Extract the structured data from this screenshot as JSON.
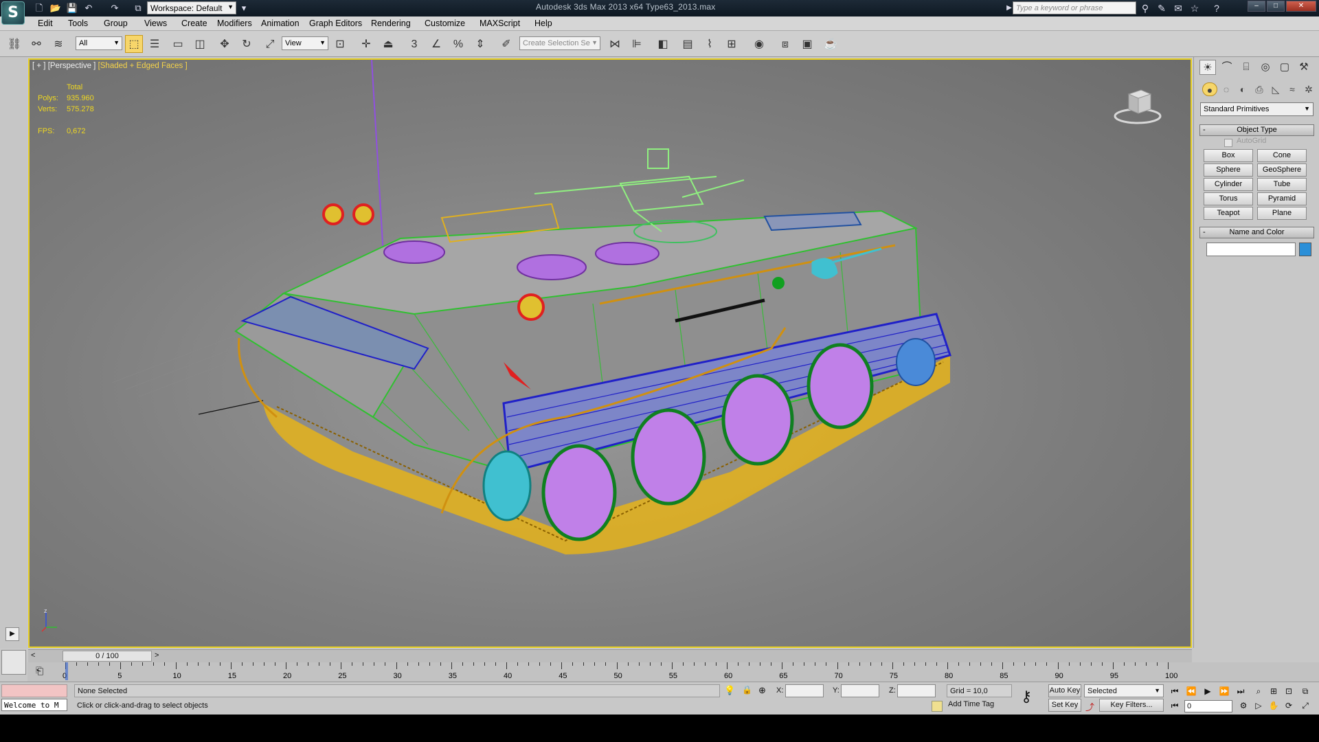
{
  "window": {
    "title": "Autodesk 3ds Max  2013 x64      Type63_2013.max",
    "workspace": "Workspace: Default",
    "search_placeholder": "Type a keyword or phrase",
    "buttons": {
      "minimize": "–",
      "maximize": "□",
      "close": "✕"
    }
  },
  "menu": [
    "Edit",
    "Tools",
    "Group",
    "Views",
    "Create",
    "Modifiers",
    "Animation",
    "Graph Editors",
    "Rendering",
    "Customize",
    "MAXScript",
    "Help"
  ],
  "toolbar": {
    "filter": "All",
    "ref_coord": "View",
    "named_selection_placeholder": "Create Selection Se",
    "snap_numbers": [
      "3",
      "%"
    ]
  },
  "viewport": {
    "label_prefix": "[ + ] [Perspective ] ",
    "label_mode": "[Shaded + Edged Faces ]",
    "stats": {
      "total_label": "Total",
      "polys_label": "Polys:",
      "polys": "935.960",
      "verts_label": "Verts:",
      "verts": "575.278",
      "fps_label": "FPS:",
      "fps": "0,672"
    },
    "axis_labels": {
      "z": "z",
      "y": "y",
      "x": "x"
    },
    "wire_colors": {
      "hull": "#30c030",
      "skirt": "#2020c8",
      "wheels": "#c080e8",
      "track": "#e0b020",
      "lights": "#e02020",
      "gun": "#90f080",
      "cables": "#d09010",
      "antenna": "#9050e0",
      "sprocket": "#40c0d0"
    }
  },
  "command_panel": {
    "category": "Standard Primitives",
    "object_type_title": "Object Type",
    "autogrid_label": "AutoGrid",
    "primitives": [
      "Box",
      "Cone",
      "Sphere",
      "GeoSphere",
      "Cylinder",
      "Tube",
      "Torus",
      "Pyramid",
      "Teapot",
      "Plane"
    ],
    "name_color_title": "Name and Color",
    "swatch_color": "#2a8fd8"
  },
  "timeline": {
    "frame_counter": "0 / 100",
    "prev": "<",
    "next": ">",
    "ticks": [
      "0",
      "5",
      "10",
      "15",
      "20",
      "25",
      "30",
      "35",
      "40",
      "45",
      "50",
      "55",
      "60",
      "65",
      "70",
      "75",
      "80",
      "85",
      "90",
      "95",
      "100"
    ]
  },
  "status": {
    "welcome": "Welcome to M",
    "selection": "None Selected",
    "prompt": "Click or click-and-drag to select objects",
    "x_label": "X:",
    "y_label": "Y:",
    "z_label": "Z:",
    "grid": "Grid = 10,0",
    "add_time_tag": "Add Time Tag",
    "auto_key": "Auto Key",
    "set_key": "Set Key",
    "selected_option": "Selected",
    "key_filters": "Key Filters...",
    "current_frame": "0"
  }
}
